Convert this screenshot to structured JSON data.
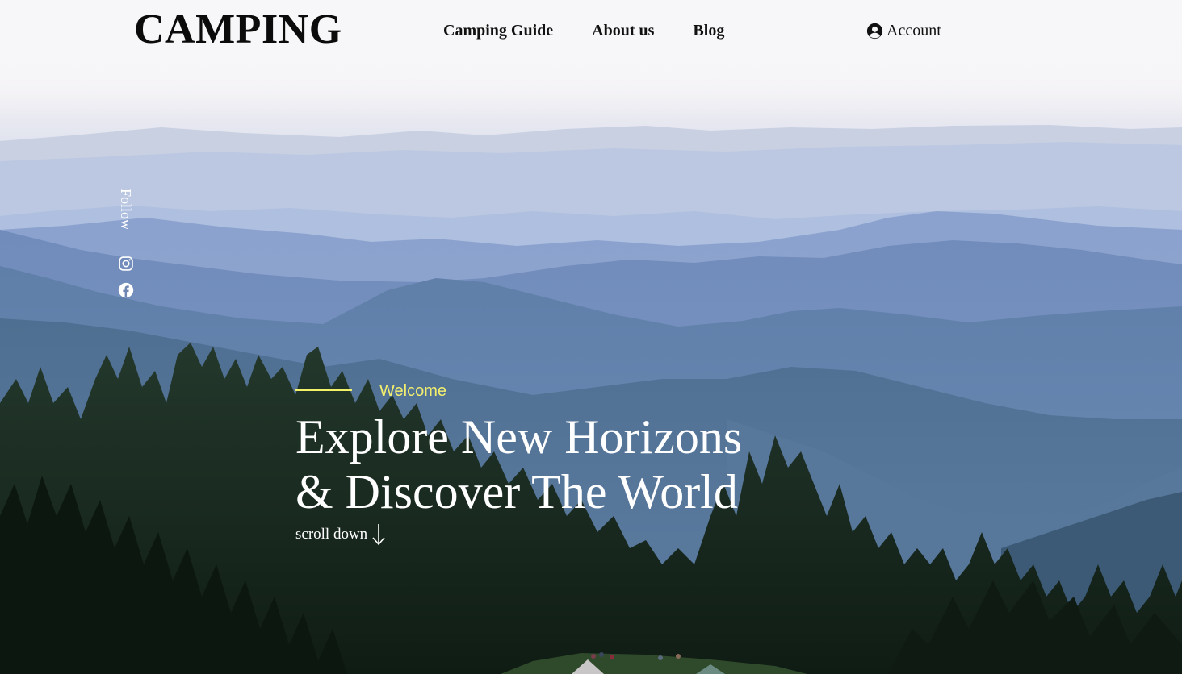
{
  "header": {
    "logo": "CAMPING",
    "nav": [
      {
        "label": "Camping Guide"
      },
      {
        "label": "About us"
      },
      {
        "label": "Blog"
      }
    ],
    "account_label": "Account",
    "account_icon": "user-circle-icon"
  },
  "sidebar": {
    "follow_label": "Follow",
    "social": [
      {
        "icon": "instagram-icon"
      },
      {
        "icon": "facebook-icon"
      }
    ]
  },
  "hero": {
    "kicker": "Welcome",
    "headline_line1": "Explore New Horizons",
    "headline_line2": "& Discover The World",
    "scroll_label": "scroll down",
    "scroll_icon": "arrow-down-icon"
  },
  "colors": {
    "accent": "#f3ef6d",
    "text_dark": "#111111",
    "text_light": "#ffffff"
  }
}
